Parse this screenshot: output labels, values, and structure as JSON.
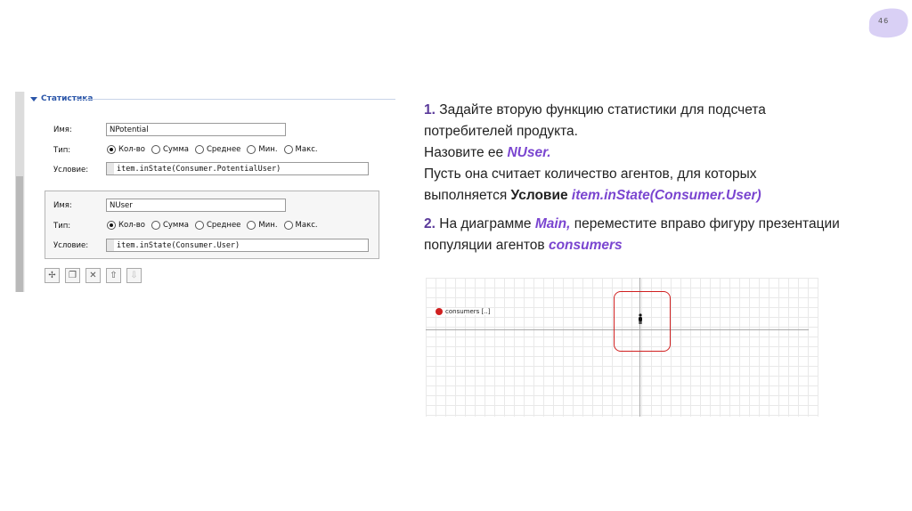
{
  "slide": {
    "page_number": "46"
  },
  "stats_panel": {
    "header": "Статистика",
    "name_label": "Имя:",
    "type_label": "Тип:",
    "condition_label": "Условие:",
    "radio_options": [
      "Кол-во",
      "Сумма",
      "Среднее",
      "Мин.",
      "Макс."
    ],
    "stat1": {
      "name": "NPotential",
      "selected": "Кол-во",
      "condition": "item.inState(Consumer.PotentialUser)"
    },
    "stat2": {
      "name": "NUser",
      "selected": "Кол-во",
      "condition": "item.inState(Consumer.User)"
    },
    "toolbar": [
      {
        "icon": "add-icon",
        "glyph": "✢",
        "enabled": true
      },
      {
        "icon": "copy-icon",
        "glyph": "❐",
        "enabled": true
      },
      {
        "icon": "delete-icon",
        "glyph": "✕",
        "enabled": true
      },
      {
        "icon": "arrow-up-icon",
        "glyph": "⇧",
        "enabled": true
      },
      {
        "icon": "arrow-down-icon",
        "glyph": "⇩",
        "enabled": false
      }
    ]
  },
  "instructions": {
    "step1_num": "1.",
    "step1_a": "Задайте вторую функцию статистики для подсчета потребителей продукта.",
    "step1_b_pre": "Назовите ее ",
    "step1_b_name": "NUser.",
    "step1_c": "Пусть она считает количество агентов, для которых выполняется ",
    "step1_c_bold": "Условие ",
    "step1_c_code": "item.inState(Consumer.User)",
    "step2_num": "2.",
    "step2_a": " На диаграмме ",
    "step2_main": "Main,",
    "step2_b": " переместите вправо фигуру презентации популяции агентов ",
    "step2_consumers": "consumers"
  },
  "diagram": {
    "population_label": "consumers [..]"
  }
}
